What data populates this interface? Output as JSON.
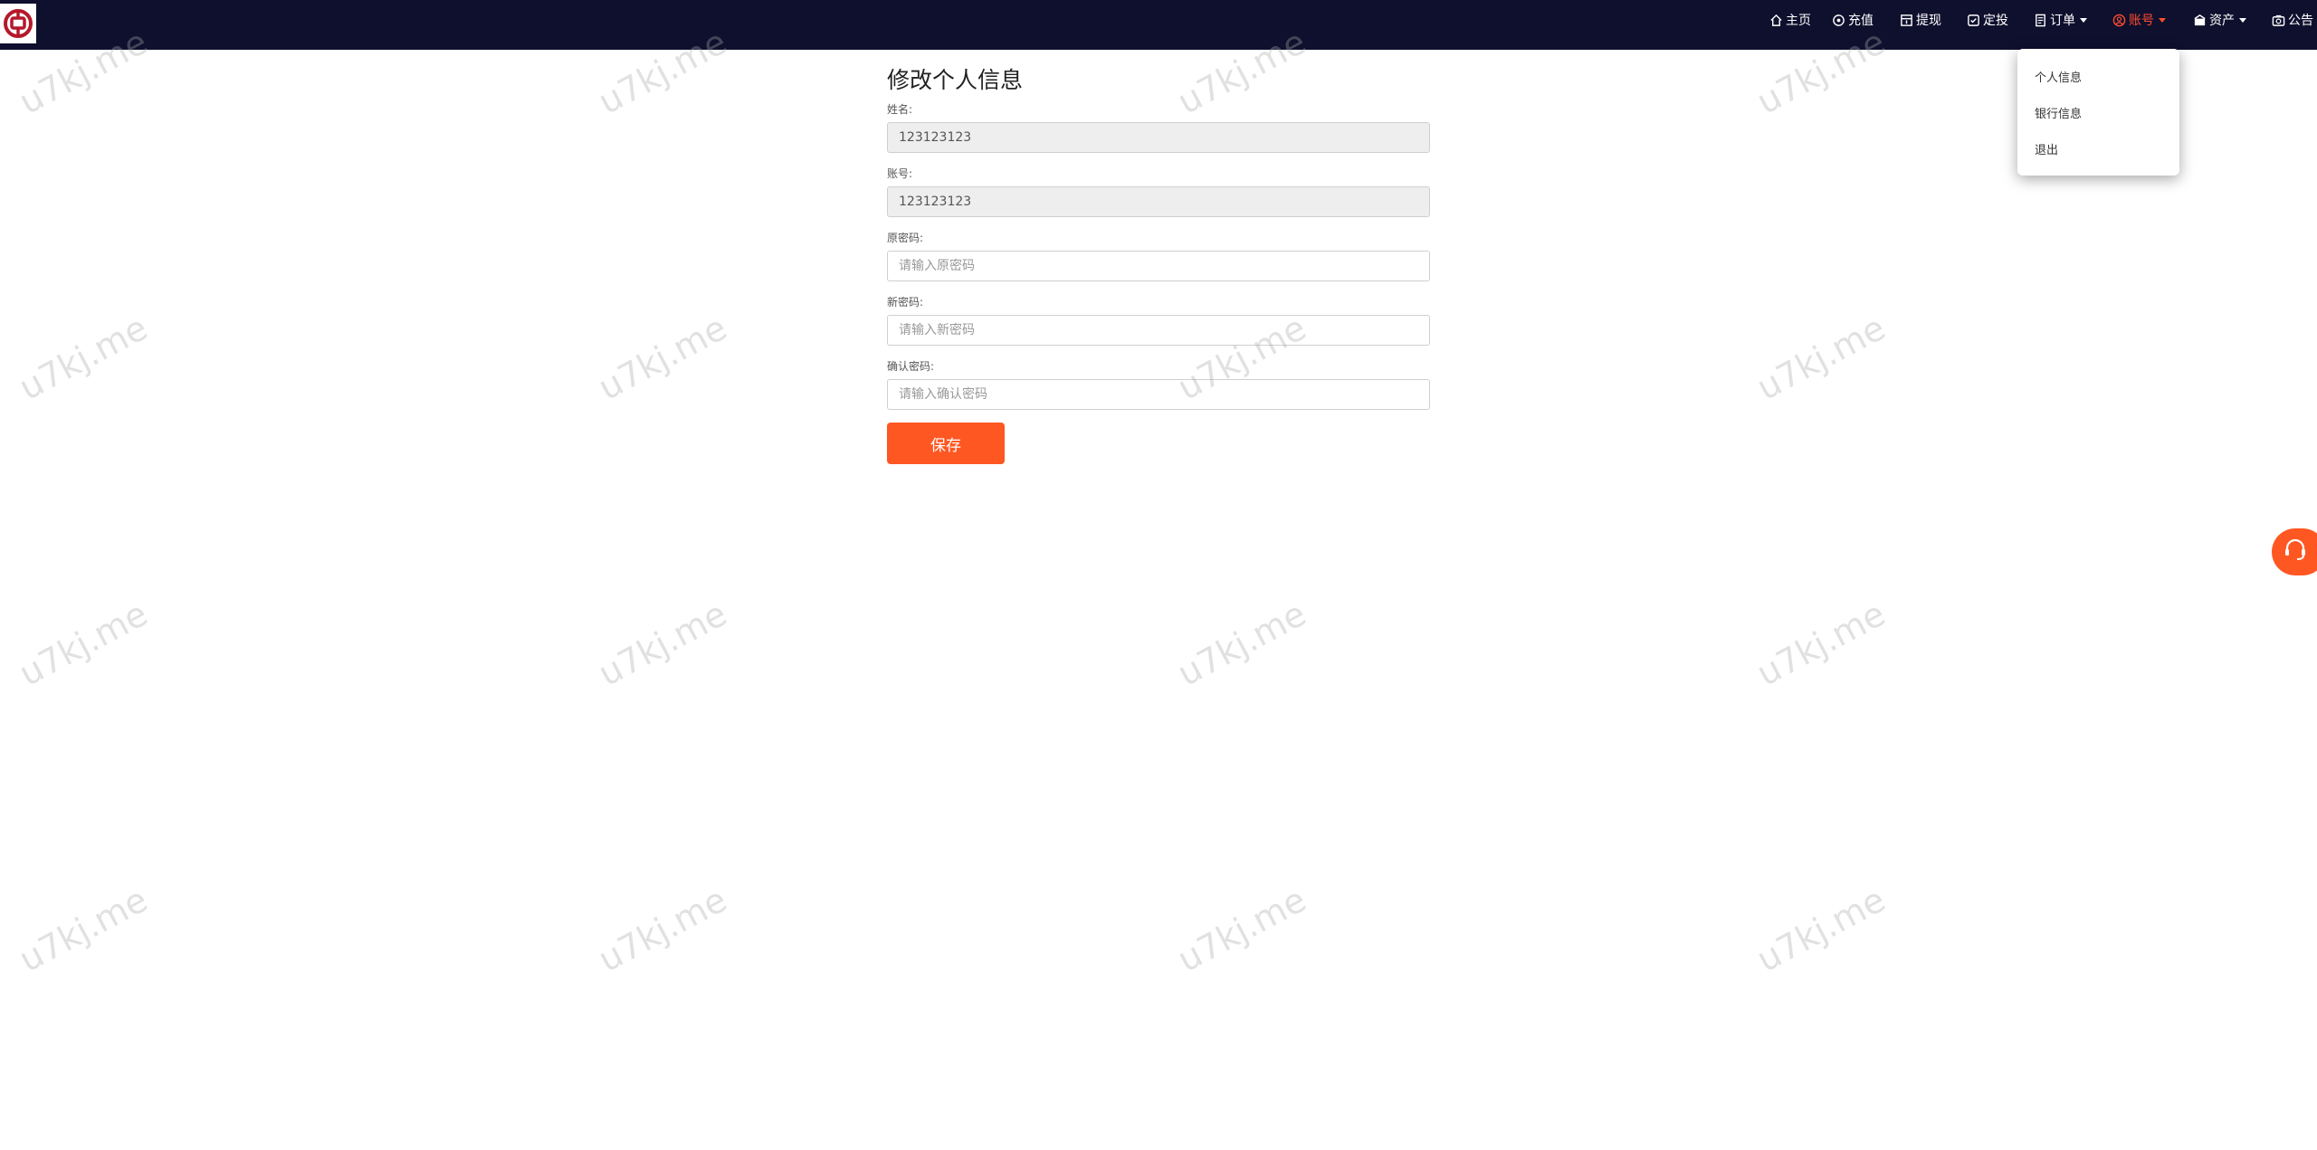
{
  "nav": {
    "home": "主页",
    "recharge": "充值",
    "withdraw": "提现",
    "fixed_invest": "定投",
    "orders": "订单",
    "account": "账号",
    "assets": "资产",
    "notice": "公告",
    "active_color": "#ff4d2e"
  },
  "account_menu": {
    "personal_info": "个人信息",
    "bank_info": "银行信息",
    "logout": "退出"
  },
  "form": {
    "title": "修改个人信息",
    "name_label": "姓名:",
    "name_value": "123123123",
    "account_label": "账号:",
    "account_value": "123123123",
    "old_password_label": "原密码:",
    "old_password_placeholder": "请输入原密码",
    "new_password_label": "新密码:",
    "new_password_placeholder": "请输入新密码",
    "confirm_password_label": "确认密码:",
    "confirm_password_placeholder": "请输入确认密码",
    "save_label": "保存"
  },
  "watermark": {
    "text": "u7kj.me"
  },
  "colors": {
    "nav_bg": "#0f0f2e",
    "accent": "#ff5722",
    "logo_red": "#b5172b"
  },
  "icons": {
    "logo": "bank-logo-icon",
    "home": "home-icon",
    "recharge": "recharge-icon",
    "withdraw": "withdraw-icon",
    "fixed_invest": "check-square-icon",
    "orders": "document-icon",
    "account": "user-circle-icon",
    "assets": "wallet-icon",
    "notice": "camera-icon",
    "support": "headset-icon"
  }
}
